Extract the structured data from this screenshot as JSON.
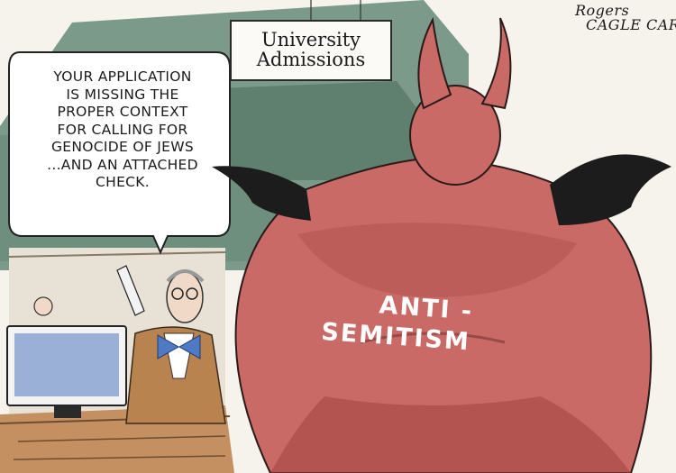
{
  "sign": {
    "line1": "University",
    "line2": "Admissions"
  },
  "speech_bubble": {
    "lines": [
      "YOUR APPLICATION",
      "IS MISSING THE",
      "PROPER CONTEXT",
      "FOR CALLING FOR",
      "GENOCIDE OF JEWS",
      "...AND AN ATTACHED",
      "CHECK."
    ]
  },
  "back_label": {
    "line1": "ANTI -",
    "line2": "SEMITISM"
  },
  "signature": {
    "line1": "Rogers",
    "line2": "CAGLE CARTOONS"
  },
  "colors": {
    "wall_green": "#6f8f7e",
    "devil_red": "#c96a66",
    "wing_black": "#1c1c1c",
    "bowtie_blue": "#4f79c4",
    "desk_brown": "#b9865a"
  }
}
